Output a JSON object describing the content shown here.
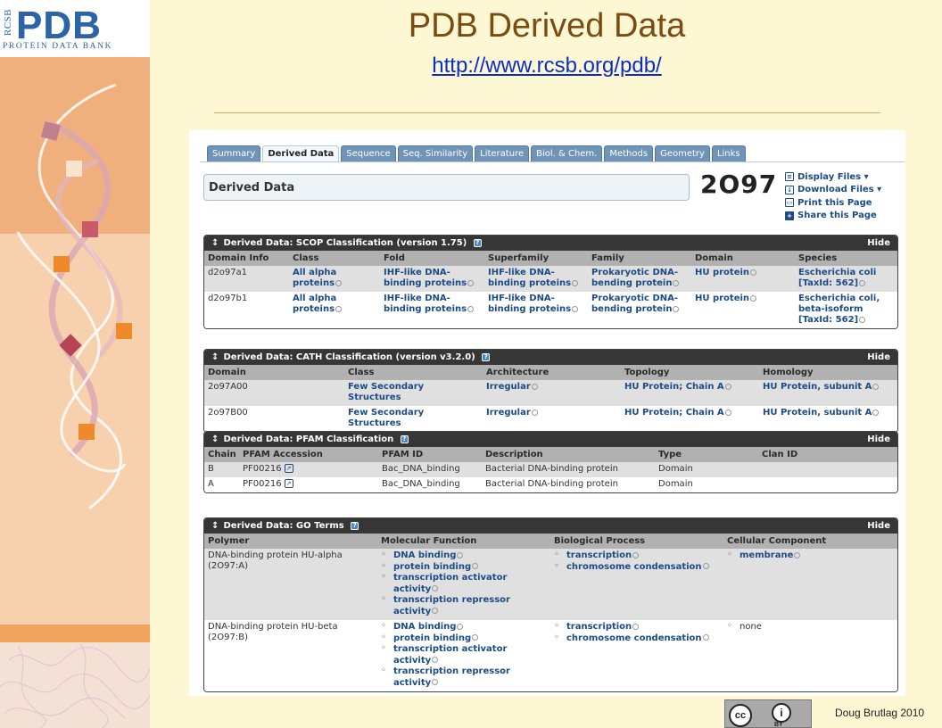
{
  "slide": {
    "title": "PDB Derived Data",
    "url": "http://www.rcsb.org/pdb/",
    "author": "Doug Brutlag 2010",
    "license_badge_text": "BY"
  },
  "logo": {
    "rcsb": "RCSB",
    "pdb": "PDB",
    "subtitle": "PROTEIN DATA BANK"
  },
  "tabs": [
    {
      "label": "Summary"
    },
    {
      "label": "Derived Data",
      "active": true
    },
    {
      "label": "Sequence"
    },
    {
      "label": "Seq. Similarity"
    },
    {
      "label": "Literature"
    },
    {
      "label": "Biol. & Chem."
    },
    {
      "label": "Methods"
    },
    {
      "label": "Geometry"
    },
    {
      "label": "Links"
    }
  ],
  "header": {
    "title": "Derived Data",
    "pdb_id": "2O97"
  },
  "side_links": [
    "Display Files ▾",
    "Download Files ▾",
    "Print this Page",
    "Share this Page"
  ],
  "scop": {
    "title": "Derived Data: SCOP Classification (version 1.75)",
    "hide": "Hide",
    "columns": [
      "Domain Info",
      "Class",
      "Fold",
      "Superfamily",
      "Family",
      "Domain",
      "Species"
    ],
    "rows": [
      {
        "domain_info": "d2o97a1",
        "class": "All alpha proteins",
        "fold": "IHF-like DNA-binding proteins",
        "superfamily": "IHF-like DNA-binding proteins",
        "family": "Prokaryotic DNA-bending protein",
        "domain": "HU protein",
        "species": "Escherichia coli [TaxId: 562]"
      },
      {
        "domain_info": "d2o97b1",
        "class": "All alpha proteins",
        "fold": "IHF-like DNA-binding proteins",
        "superfamily": "IHF-like DNA-binding proteins",
        "family": "Prokaryotic DNA-bending protein",
        "domain": "HU protein",
        "species": "Escherichia coli, beta-isoform [TaxId: 562]"
      }
    ]
  },
  "cath": {
    "title": "Derived Data: CATH Classification (version v3.2.0)",
    "hide": "Hide",
    "columns": [
      "Domain",
      "Class",
      "Architecture",
      "Topology",
      "Homology"
    ],
    "rows": [
      {
        "domain": "2o97A00",
        "class": "Few Secondary Structures",
        "architecture": "Irregular",
        "topology": "HU Protein; Chain A",
        "homology": "HU Protein, subunit A"
      },
      {
        "domain": "2o97B00",
        "class": "Few Secondary Structures",
        "architecture": "Irregular",
        "topology": "HU Protein; Chain A",
        "homology": "HU Protein, subunit A"
      }
    ]
  },
  "pfam": {
    "title": "Derived Data: PFAM Classification",
    "hide": "Hide",
    "columns": [
      "Chain",
      "PFAM Accession",
      "PFAM ID",
      "Description",
      "Type",
      "Clan ID"
    ],
    "rows": [
      {
        "chain": "B",
        "accession": "PF00216",
        "pfam_id": "Bac_DNA_binding",
        "description": "Bacterial DNA-binding protein",
        "type": "Domain",
        "clan": ""
      },
      {
        "chain": "A",
        "accession": "PF00216",
        "pfam_id": "Bac_DNA_binding",
        "description": "Bacterial DNA-binding protein",
        "type": "Domain",
        "clan": ""
      }
    ]
  },
  "go": {
    "title": "Derived Data: GO Terms",
    "hide": "Hide",
    "columns": [
      "Polymer",
      "Molecular Function",
      "Biological Process",
      "Cellular Component"
    ],
    "rows": [
      {
        "polymer": "DNA-binding protein HU-alpha (2O97:A)",
        "molecular_function": [
          "DNA binding",
          "protein binding",
          "transcription activator activity",
          "transcription repressor activity"
        ],
        "biological_process": [
          "transcription",
          "chromosome condensation"
        ],
        "cellular_component": [
          "membrane"
        ],
        "cc_plain": false
      },
      {
        "polymer": "DNA-binding protein HU-beta (2O97:B)",
        "molecular_function": [
          "DNA binding",
          "protein binding",
          "transcription activator activity",
          "transcription repressor activity"
        ],
        "biological_process": [
          "transcription",
          "chromosome condensation"
        ],
        "cellular_component": [
          "none"
        ],
        "cc_plain": true
      }
    ]
  },
  "colors": {
    "title_brown": "#7a4b12",
    "url_blue": "#0b2ec8",
    "link_blue": "#1c4b88",
    "section_header": "#363636",
    "column_header": "#b1b1b1",
    "row_shade": "#e0e0e0",
    "slide_bg": "#fdf7d4"
  }
}
